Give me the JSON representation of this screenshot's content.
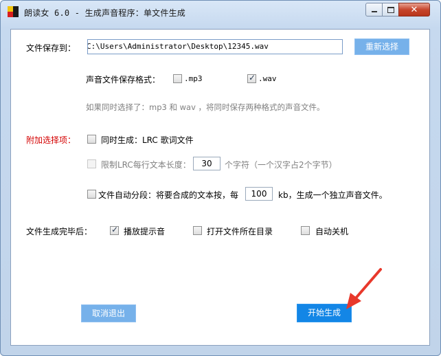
{
  "window": {
    "title": "朗读女 6.0 - 生成声音程序：单文件生成",
    "controls": {
      "minimize": "minimize",
      "maximize": "maximize",
      "close": "close"
    }
  },
  "save_path": {
    "label": "文件保存到：",
    "value": "C:\\Users\\Administrator\\Desktop\\12345.wav",
    "reselect_button": "重新选择"
  },
  "format": {
    "label": "声音文件保存格式：",
    "options": [
      {
        "label": ".mp3",
        "checked": false
      },
      {
        "label": ".wav",
        "checked": true
      }
    ],
    "hint": "如果同时选择了：mp3 和 wav ，将同时保存两种格式的声音文件。"
  },
  "extra": {
    "label": "附加选择项：",
    "lrc": {
      "label": "同时生成：LRC 歌词文件",
      "checked": false
    },
    "lrc_limit": {
      "prefix": "限制LRC每行文本长度：",
      "value": "30",
      "suffix": "个字符（一个汉字占2个字节）",
      "checked": false,
      "enabled": false
    },
    "split": {
      "prefix": "文件自动分段：将要合成的文本按，每",
      "value": "100",
      "suffix": "kb，生成一个独立声音文件。",
      "checked": false
    }
  },
  "on_complete": {
    "label": "文件生成完毕后：",
    "options": [
      {
        "label": "播放提示音",
        "checked": true
      },
      {
        "label": "打开文件所在目录",
        "checked": false
      },
      {
        "label": "自动关机",
        "checked": false
      }
    ]
  },
  "buttons": {
    "cancel": "取消退出",
    "start": "开始生成"
  },
  "colors": {
    "accent": "#1386e6",
    "accent_light": "#76b1ea",
    "warning": "#d40000",
    "arrow": "#e8382b"
  }
}
